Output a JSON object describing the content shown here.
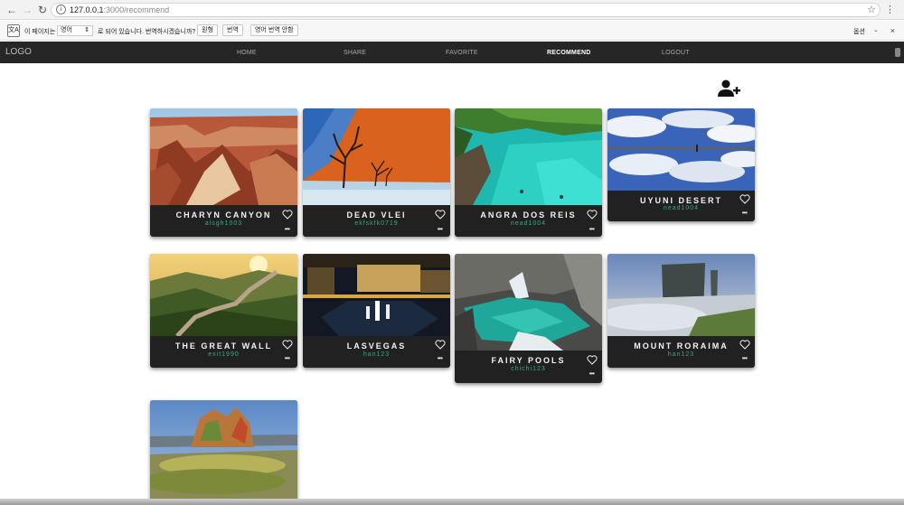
{
  "browser": {
    "url_host": "127.0.0.1",
    "url_path": ":3000/recommend",
    "translate_text_before": "이 페이지는",
    "translate_lang": "영어",
    "translate_text_after": "로 되어 있습니다. 번역하시겠습니까?",
    "btn_original": "원형",
    "btn_translate": "번역",
    "btn_never": "영어 번역 안함",
    "options": "옵션"
  },
  "navbar": {
    "logo": "LOGO",
    "links": [
      "HOME",
      "SHARE",
      "FAVORITE",
      "RECOMMEND",
      "LOGOUT"
    ],
    "active": "RECOMMEND"
  },
  "cards": [
    {
      "title": "CHARYN CANYON",
      "author": "alsgh1003"
    },
    {
      "title": "DEAD VLEI",
      "author": "ekfskfk0719"
    },
    {
      "title": "ANGRA DOS REIS",
      "author": "nead1004"
    },
    {
      "title": "UYUNI DESERT",
      "author": "nead1004"
    },
    {
      "title": "THE GREAT WALL",
      "author": "exit1990"
    },
    {
      "title": "LASVEGAS",
      "author": "han123"
    },
    {
      "title": "FAIRY POOLS",
      "author": "chichi123"
    },
    {
      "title": "MOUNT RORAIMA",
      "author": "han123"
    },
    {
      "title": "",
      "author": ""
    }
  ],
  "colors": {
    "navbar": "#262626",
    "card": "#212121",
    "author": "#39a889"
  }
}
